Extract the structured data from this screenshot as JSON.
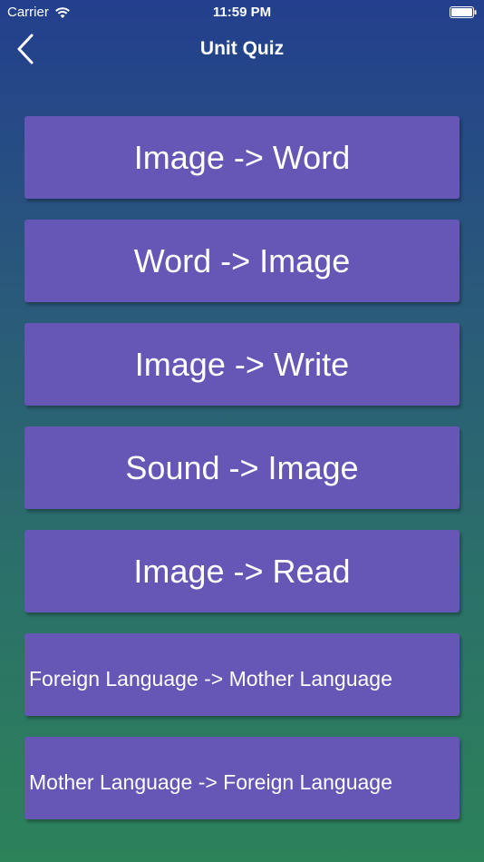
{
  "status_bar": {
    "carrier": "Carrier",
    "time": "11:59 PM"
  },
  "nav": {
    "title": "Unit Quiz",
    "back_icon": "chevron-left-icon"
  },
  "quiz_modes": [
    {
      "label": "Image -> Word"
    },
    {
      "label": "Word -> Image"
    },
    {
      "label": "Image -> Write"
    },
    {
      "label": "Sound -> Image"
    },
    {
      "label": "Image -> Read"
    },
    {
      "label": "Foreign Language -> Mother Language"
    },
    {
      "label": "Mother Language -> Foreign Language"
    }
  ],
  "colors": {
    "button": "#6656b6",
    "gradient_top": "#233f8e",
    "gradient_bottom": "#2c8259"
  }
}
